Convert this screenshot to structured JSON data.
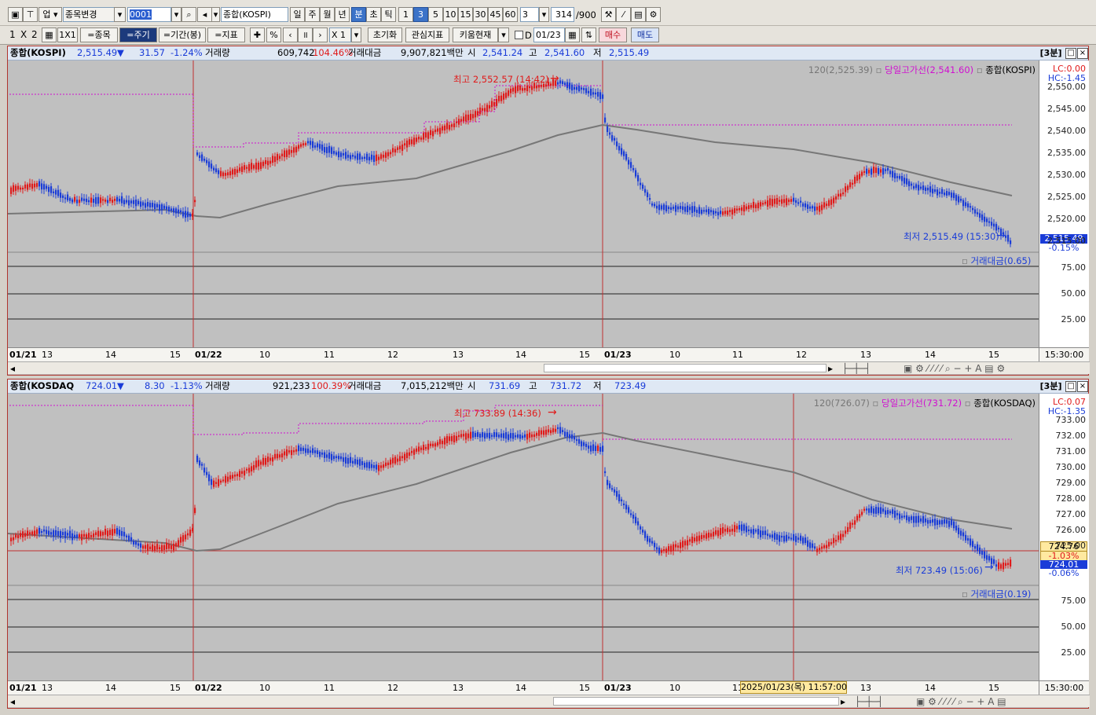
{
  "toolbar1": {
    "market_label": "업",
    "change_stock_label": "종목변경",
    "code_value": "0001",
    "index_name": "종합(KOSPI)",
    "periods": [
      "일",
      "주",
      "월",
      "년",
      "분",
      "초",
      "틱"
    ],
    "selected_period": "분",
    "minutes": [
      "1",
      "3",
      "5",
      "10",
      "15",
      "30",
      "45",
      "60"
    ],
    "selected_minute": "3",
    "interval_value": "3",
    "count_value": "314",
    "count_max": "/900"
  },
  "toolbar2": {
    "layout_labels": [
      "1",
      "X",
      "2"
    ],
    "layout_1x1": "1X1",
    "stock_btn": "=종목",
    "period_btn": "=주기",
    "range_btn": "=기간(봉)",
    "indicator_btn": "=지표",
    "percent_label": "%",
    "multiplier": "X 1",
    "reset_btn": "초기화",
    "interest_btn": "관심지표",
    "kiwoom_btn": "키움현재",
    "d_label": "D",
    "date_value": "01/23",
    "buy_btn": "매수",
    "sell_btn": "매도"
  },
  "kospi": {
    "title": "종합(KOSPI)",
    "price": "2,515.49",
    "arrow": "▼",
    "change": "31.57",
    "pct": "-1.24%",
    "vol_label": "거래량",
    "vol": "609,742",
    "vol_pct": "104.46%",
    "amount_label": "거래대금",
    "amount": "9,907,821백만",
    "open_label": "시",
    "open": "2,541.24",
    "high_label": "고",
    "high": "2,541.60",
    "low_label": "저",
    "low": "2,515.49",
    "interval_tag": "[3분]",
    "legend_ma": "120(2,525.39)",
    "legend_highline": "당일고가선(2,541.60)",
    "legend_series": "종합(KOSPI)",
    "lc": "LC:0.00",
    "hc": "HC:-1.45",
    "max_label": "최고 2,552.57 (14:42)",
    "min_label": "최저 2,515.49 (15:30)",
    "price_tag": "2,515.49",
    "pct_tag": "-0.15%",
    "vol_legend": "거래대금(0.65)",
    "yticks": [
      "2,550.00",
      "2,545.00",
      "2,540.00",
      "2,535.00",
      "2,530.00",
      "2,525.00",
      "2,520.00",
      "2,515.00"
    ],
    "vticks": [
      "75.00",
      "50.00",
      "25.00"
    ],
    "date_labels": [
      "01/21",
      "13",
      "14",
      "15",
      "01/22",
      "10",
      "11",
      "12",
      "13",
      "14",
      "15",
      "01/23",
      "10",
      "11",
      "12",
      "13",
      "14",
      "15"
    ],
    "axis_time": "15:30:00"
  },
  "kosdaq": {
    "title": "종합(KOSDAQ",
    "price": "724.01",
    "arrow": "▼",
    "change": "8.30",
    "pct": "-1.13%",
    "vol_label": "거래량",
    "vol": "921,233",
    "vol_pct": "100.39%",
    "amount_label": "거래대금",
    "amount": "7,015,212백만",
    "open_label": "시",
    "open": "731.69",
    "high_label": "고",
    "high": "731.72",
    "low_label": "저",
    "low": "723.49",
    "interval_tag": "[3분]",
    "legend_ma": "120(726.07)",
    "legend_highline": "당일고가선(731.72)",
    "legend_series": "종합(KOSDAQ)",
    "lc": "LC:0.07",
    "hc": "HC:-1.35",
    "max_label": "최고 733.89 (14:36)",
    "min_label": "최저 723.49 (15:06)",
    "cursor_tag": "724.76",
    "cursor_pct": "-1.03%",
    "price_tag": "724.01",
    "pct_tag": "-0.06%",
    "vol_legend": "거래대금(0.19)",
    "yticks": [
      "733.00",
      "732.00",
      "731.00",
      "730.00",
      "729.00",
      "728.00",
      "727.00",
      "726.00",
      "725.00"
    ],
    "vticks": [
      "75.00",
      "50.00",
      "25.00"
    ],
    "date_labels": [
      "01/21",
      "13",
      "14",
      "15",
      "01/22",
      "10",
      "11",
      "12",
      "13",
      "14",
      "15",
      "01/23",
      "10",
      "11",
      "12",
      "13",
      "14",
      "15"
    ],
    "cursor_time": "2025/01/23(목) 11:57:00",
    "axis_time": "15:30:00"
  },
  "colors": {
    "up": "#e01a1a",
    "down": "#1a3cd8",
    "ma": "#777777",
    "highline": "#d010d0"
  }
}
